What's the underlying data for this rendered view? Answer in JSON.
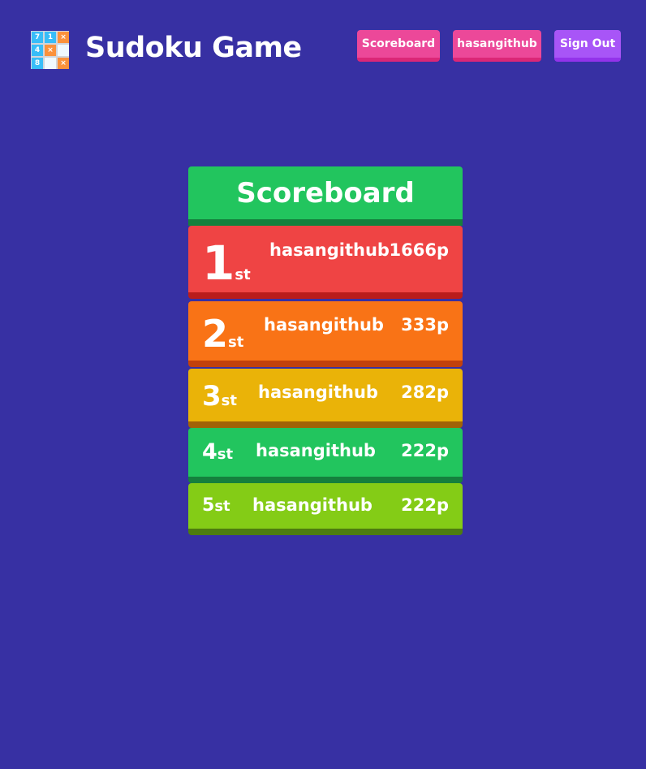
{
  "header": {
    "title": "Sudoku Game",
    "logo_cells": [
      "7",
      "1",
      "×",
      "4",
      "×",
      "",
      "8",
      "",
      "×"
    ],
    "nav": {
      "scoreboard": "Scoreboard",
      "user": "hasangithub",
      "signout": "Sign Out"
    }
  },
  "scoreboard": {
    "title": "Scoreboard",
    "rows": [
      {
        "rank": "1",
        "suffix": "st",
        "name": "hasangithub",
        "points": "1666p"
      },
      {
        "rank": "2",
        "suffix": "st",
        "name": "hasangithub",
        "points": "333p"
      },
      {
        "rank": "3",
        "suffix": "st",
        "name": "hasangithub",
        "points": "282p"
      },
      {
        "rank": "4",
        "suffix": "st",
        "name": "hasangithub",
        "points": "222p"
      },
      {
        "rank": "5",
        "suffix": "st",
        "name": "hasangithub",
        "points": "222p"
      }
    ]
  },
  "colors": {
    "background": "#3730a3",
    "pink_button": "#ec4899",
    "purple_button": "#a855f7",
    "row1": "#ef4444",
    "row2": "#f97316",
    "row3": "#eab308",
    "row4": "#22c55e",
    "row5": "#84cc16"
  }
}
